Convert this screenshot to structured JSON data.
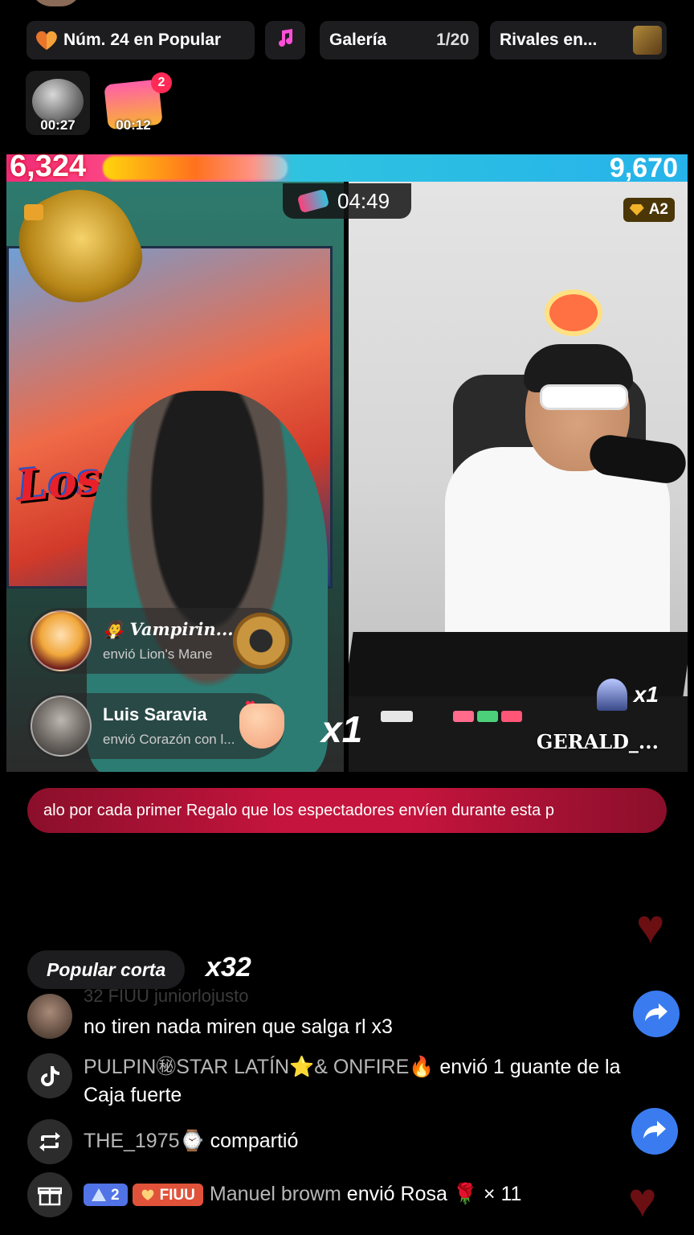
{
  "top_bar": {
    "rank_label": "Núm. 24 en Popular",
    "gallery_label": "Galería",
    "gallery_count": "1/20",
    "rivals_label": "Rivales en..."
  },
  "timers": [
    {
      "time": "00:27"
    },
    {
      "time": "00:12",
      "badge": "2"
    }
  ],
  "battle": {
    "score_left": "6,324",
    "score_right": "9,670",
    "timer": "04:49",
    "right_badge": "A2",
    "right_multiplier": "x1",
    "right_name": "GERALD_...",
    "left_multiplier": "x1",
    "poster_text": "Los Ch..."
  },
  "gifts": [
    {
      "name": "Vampirin...",
      "sub": "envió Lion's Mane"
    },
    {
      "name": "Luis Saravia",
      "sub": "envió Corazón con l..."
    }
  ],
  "banner_text": "alo por cada primer Regalo que los espectadores envíen durante esta p",
  "popular": {
    "label": "Popular corta",
    "multiplier": "x32"
  },
  "chat": {
    "faded": "32  FIUU  juniorlojusto",
    "messages": [
      {
        "text": "no tiren nada miren que salga rl x3"
      },
      {
        "who": "PULPIN㊙STAR LATÍN⭐& ONFIRE🔥",
        "act": " envió 1 guante de la Caja fuerte"
      },
      {
        "who": "THE_1975⌚",
        "act": " compartió"
      },
      {
        "level": "2",
        "fan": "FIUU",
        "who": "Manuel browm",
        "act": " envió Rosa 🌹 × 11"
      }
    ]
  },
  "colors": {
    "accent_pink": "#f02a75",
    "accent_blue": "#26b3ea",
    "share_blue": "#3a7cf0",
    "banner_red": "#c5143d"
  }
}
